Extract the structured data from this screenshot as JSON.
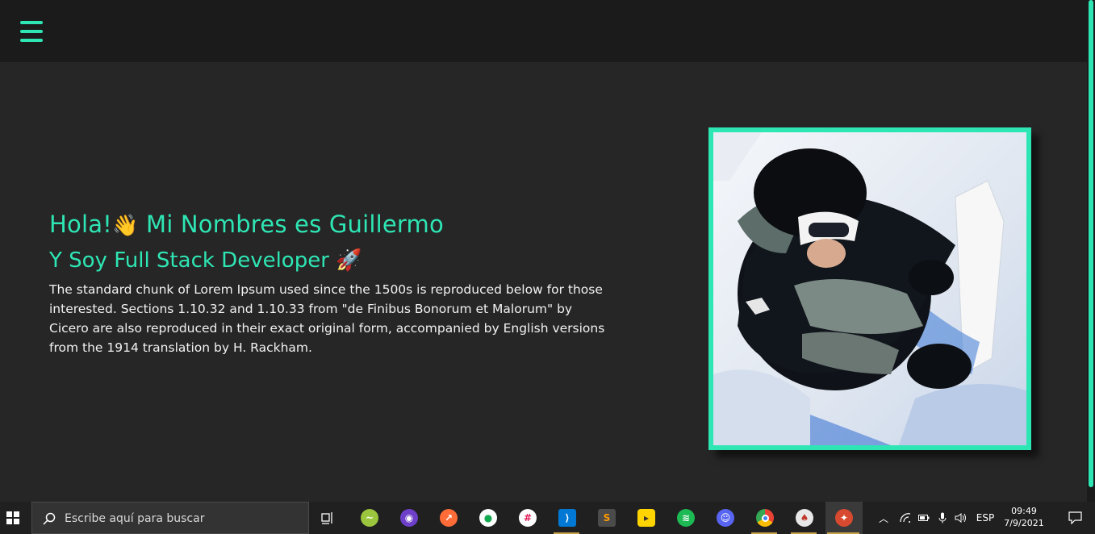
{
  "hero": {
    "greeting": "Hola!",
    "greeting_emoji": "👋",
    "greeting_rest": " Mi Nombres es Guillermo",
    "role": "Y Soy Full Stack Developer ",
    "role_emoji": "🚀",
    "bio": "The standard chunk of Lorem Ipsum used since the 1500s is reproduced below for those interested. Sections 1.10.32 and 1.10.33 from \"de Finibus Bonorum et Malorum\" by Cicero are also reproduced in their exact original form, accompanied by English versions from the 1914 translation by H. Rackham."
  },
  "colors": {
    "accent": "#2ee6b4",
    "background": "#262626",
    "topbar": "#1b1b1b",
    "taskbar": "#202020"
  },
  "taskbar": {
    "search_placeholder": "Escribe aquí para buscar",
    "apps": [
      {
        "icon": "task-view-icon"
      },
      {
        "icon": "chameleon-app-icon"
      },
      {
        "icon": "github-desktop-icon"
      },
      {
        "icon": "postman-icon"
      },
      {
        "icon": "mongodb-compass-icon"
      },
      {
        "icon": "slack-icon"
      },
      {
        "icon": "vscode-icon"
      },
      {
        "icon": "sublime-text-icon"
      },
      {
        "icon": "notes-app-icon"
      },
      {
        "icon": "spotify-icon"
      },
      {
        "icon": "discord-icon"
      },
      {
        "icon": "chrome-icon"
      },
      {
        "icon": "mushroom-app-icon"
      },
      {
        "icon": "ninja-app-icon"
      }
    ],
    "language": "ESP",
    "time": "09:49",
    "date": "7/9/2021"
  }
}
